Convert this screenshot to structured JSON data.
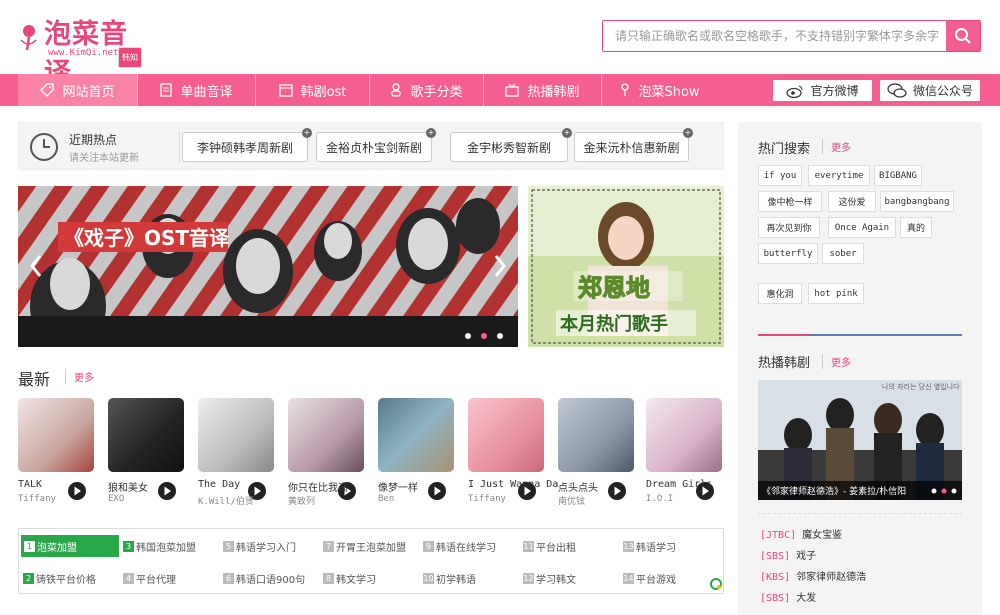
{
  "header": {
    "logo_name": "泡菜音译",
    "logo_site": "www.KimQi.net",
    "logo_tag": "韩知",
    "search_placeholder": "请只输正确歌名或歌名空格歌手，不支持错别字繁体字多余字"
  },
  "nav": {
    "items": [
      {
        "label": "网站首页",
        "icon": "tag-icon"
      },
      {
        "label": "单曲音译",
        "icon": "document-icon"
      },
      {
        "label": "韩剧ost",
        "icon": "video-icon"
      },
      {
        "label": "歌手分类",
        "icon": "user-icon"
      },
      {
        "label": "热播韩剧",
        "icon": "tv-icon"
      },
      {
        "label": "泡菜Show",
        "icon": "mic-icon"
      }
    ],
    "weibo": "官方微博",
    "wechat": "微信公众号"
  },
  "hot": {
    "title": "近期热点",
    "subtitle": "请关注本站更新",
    "pills": [
      "李钟硕韩孝周新剧",
      "金裕贞朴宝剑新剧",
      "金宇彬秀智新剧",
      "金来沅朴信惠新剧"
    ]
  },
  "banner": {
    "left_title": "《戏子》OST音译",
    "right_name": "郑恩地",
    "right_sub": "本月热门歌手"
  },
  "newest": {
    "title": "最新",
    "more": "更多",
    "songs": [
      {
        "title": "TALK",
        "artist": "Tiffany"
      },
      {
        "title": "狼和美女",
        "artist": "EXO"
      },
      {
        "title": "The Day",
        "artist": "K.Will/伯贤"
      },
      {
        "title": "你只在比我高",
        "artist": "黄致列"
      },
      {
        "title": "像梦一样",
        "artist": "Ben"
      },
      {
        "title": "I Just Wanna Da",
        "artist": "Tiffany"
      },
      {
        "title": "点头点头",
        "artist": "南优铉"
      },
      {
        "title": "Dream Girls",
        "artist": "I.O.I"
      }
    ]
  },
  "links": {
    "row1": [
      {
        "n": "1",
        "label": "泡菜加盟"
      },
      {
        "n": "3",
        "label": "韩国泡菜加盟"
      },
      {
        "n": "5",
        "label": "韩语学习入门"
      },
      {
        "n": "7",
        "label": "开胃王泡菜加盟"
      },
      {
        "n": "9",
        "label": "韩语在线学习"
      },
      {
        "n": "11",
        "label": "平台出租"
      },
      {
        "n": "13",
        "label": "韩语学习"
      }
    ],
    "row2": [
      {
        "n": "2",
        "label": "铸铁平台价格"
      },
      {
        "n": "4",
        "label": "平台代理"
      },
      {
        "n": "6",
        "label": "韩语口语900句"
      },
      {
        "n": "8",
        "label": "韩文学习"
      },
      {
        "n": "10",
        "label": "初学韩语"
      },
      {
        "n": "12",
        "label": "学习韩文"
      },
      {
        "n": "14",
        "label": "平台游戏"
      }
    ]
  },
  "right": {
    "hot_search_title": "热门搜索",
    "hot_search_more": "更多",
    "tags": [
      "if you",
      "everytime",
      "BIGBANG",
      "像中枪一样",
      "这份爱",
      "bangbangbang",
      "再次见到你",
      "Once Again",
      "真的",
      "butterfly",
      "sober",
      "惠化洞",
      "hot pink"
    ],
    "drama_title": "热播韩剧",
    "drama_more": "更多",
    "drama_caption": "《邻家律师赵德浩》- 姜素拉/朴信阳",
    "drama_img_text": "나의 자리는 당신 옆입니다",
    "dramas": [
      {
        "net": "[JTBC]",
        "name": "魔女宝鉴"
      },
      {
        "net": "[SBS]",
        "name": "戏子"
      },
      {
        "net": "[KBS]",
        "name": "邻家律师赵德浩"
      },
      {
        "net": "[SBS]",
        "name": "大发"
      }
    ]
  },
  "colors": {
    "brand": "#f45f8f",
    "accent_text": "#e8477b",
    "green": "#29a84a"
  }
}
